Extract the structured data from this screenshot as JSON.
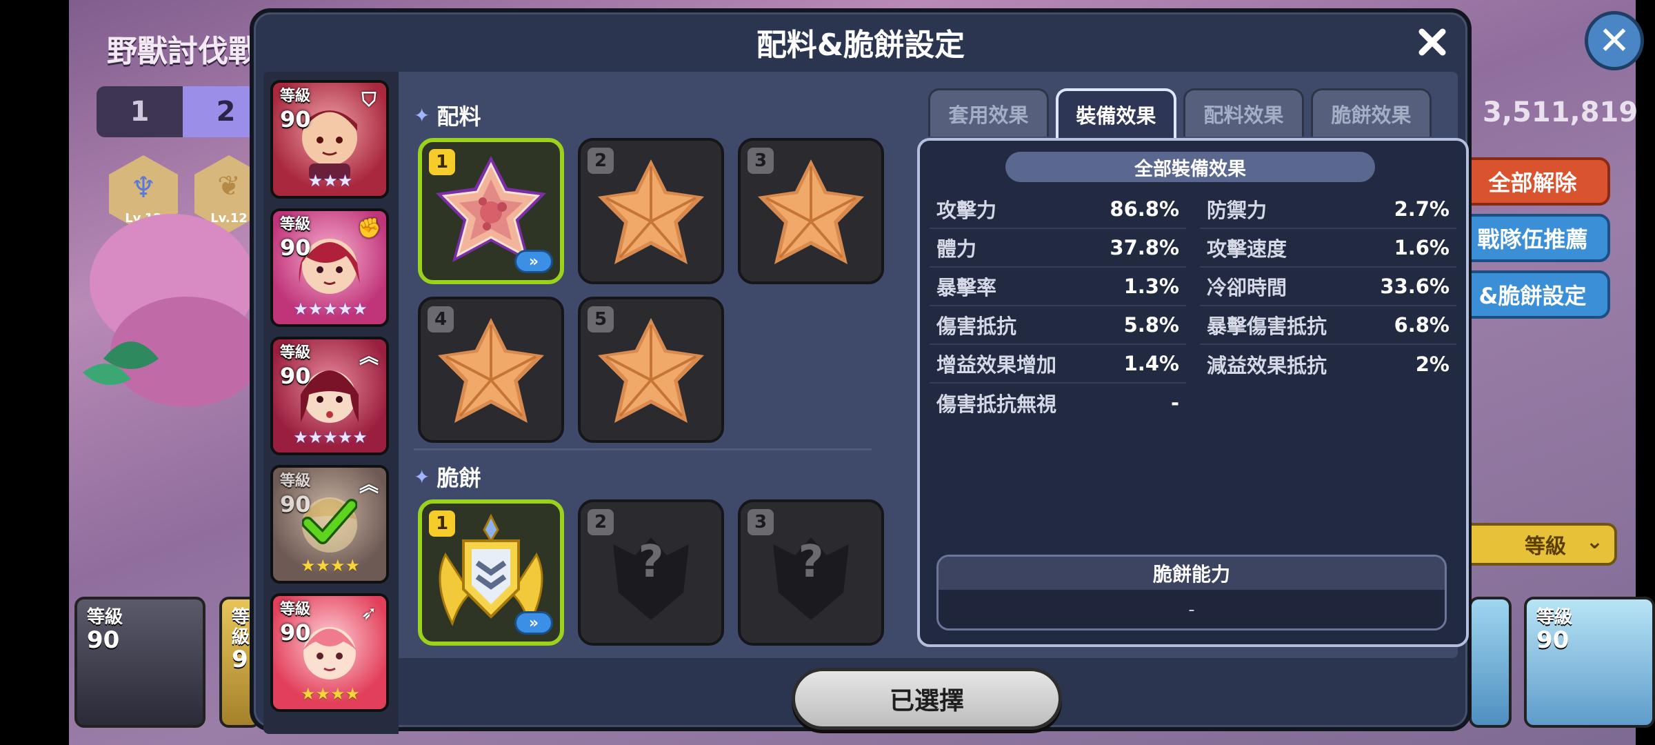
{
  "background": {
    "title": "野獸討伐戰",
    "tabs": [
      "1",
      "2"
    ],
    "hex_badges": [
      {
        "label": "Lv.12",
        "icon": "trident-icon"
      },
      {
        "label": "Lv.12",
        "icon": "beast-icon"
      }
    ],
    "score": "3,511,819",
    "buttons": {
      "unequip_all": "全部解除",
      "recommend": "戰隊伍推薦",
      "topping_setting": "&脆餅設定"
    },
    "sort_select": "等級",
    "bottom_cards": [
      {
        "level_label": "等級",
        "level": "90"
      },
      {
        "level_label": "等級",
        "level": "9"
      },
      {
        "level_label": "等級",
        "level": "90"
      }
    ],
    "colors": {
      "red_button": "#d9542e",
      "blue_button": "#3b8fd6",
      "sort_yellow": "#e7c238"
    }
  },
  "modal": {
    "title": "配料&脆餅設定",
    "close_icon": "close-icon",
    "cookies": [
      {
        "level_label": "等級",
        "level": "90",
        "role_icon": "shield-icon",
        "stars": "★★★",
        "star_style": "blue",
        "color": "#c2324a",
        "selected": true
      },
      {
        "level_label": "等級",
        "level": "90",
        "role_icon": "fist-icon",
        "stars": "★★★★★",
        "star_style": "blue",
        "color": "#d24a82",
        "selected": false
      },
      {
        "level_label": "等級",
        "level": "90",
        "role_icon": "rank-up-icon",
        "stars": "★★★★★",
        "star_style": "blue",
        "color": "#b42c4a",
        "selected": false
      },
      {
        "level_label": "等級",
        "level": "90",
        "role_icon": "rank-up-icon",
        "stars": "★★★★",
        "star_style": "gold",
        "color": "#8b7a6a",
        "selected": false,
        "checked": true
      },
      {
        "level_label": "等級",
        "level": "90",
        "role_icon": "bow-icon",
        "stars": "★★★★",
        "star_style": "gold",
        "color": "#e6485e",
        "selected": false
      }
    ],
    "toppings_label": "配料",
    "toppings": [
      {
        "num": "1",
        "selected": true,
        "variant": "jewel"
      },
      {
        "num": "2",
        "selected": false,
        "variant": "plain"
      },
      {
        "num": "3",
        "selected": false,
        "variant": "plain"
      },
      {
        "num": "4",
        "selected": false,
        "variant": "plain"
      },
      {
        "num": "5",
        "selected": false,
        "variant": "plain"
      }
    ],
    "biscuits_label": "脆餅",
    "biscuits": [
      {
        "num": "1",
        "selected": true,
        "variant": "gold-wings"
      },
      {
        "num": "2",
        "selected": false,
        "variant": "empty",
        "placeholder": "?"
      },
      {
        "num": "3",
        "selected": false,
        "variant": "empty",
        "placeholder": "?"
      }
    ],
    "detail_icon": "double-chevron-right-icon",
    "tabs": [
      {
        "label": "套用效果",
        "active": false
      },
      {
        "label": "裝備效果",
        "active": true
      },
      {
        "label": "配料效果",
        "active": false
      },
      {
        "label": "脆餅效果",
        "active": false
      }
    ],
    "effects": {
      "header": "全部裝備效果",
      "left": [
        {
          "label": "攻擊力",
          "value": "86.8%"
        },
        {
          "label": "體力",
          "value": "37.8%"
        },
        {
          "label": "暴擊率",
          "value": "1.3%"
        },
        {
          "label": "傷害抵抗",
          "value": "5.8%"
        },
        {
          "label": "增益效果增加",
          "value": "1.4%"
        },
        {
          "label": "傷害抵抗無視",
          "value": "-"
        }
      ],
      "right": [
        {
          "label": "防禦力",
          "value": "2.7%"
        },
        {
          "label": "攻擊速度",
          "value": "1.6%"
        },
        {
          "label": "冷卻時間",
          "value": "33.6%"
        },
        {
          "label": "暴擊傷害抵抗",
          "value": "6.8%"
        },
        {
          "label": "減益效果抵抗",
          "value": "2%"
        }
      ],
      "biscuit_ability": {
        "title": "脆餅能力",
        "value": "-"
      }
    },
    "confirm_button": "已選擇",
    "colors": {
      "selected_border": "#9ad21c",
      "slot_number_selected": "#f6cc2a",
      "detail_button": "#3b8fe4",
      "topping_orange": "#e8a15e"
    }
  }
}
